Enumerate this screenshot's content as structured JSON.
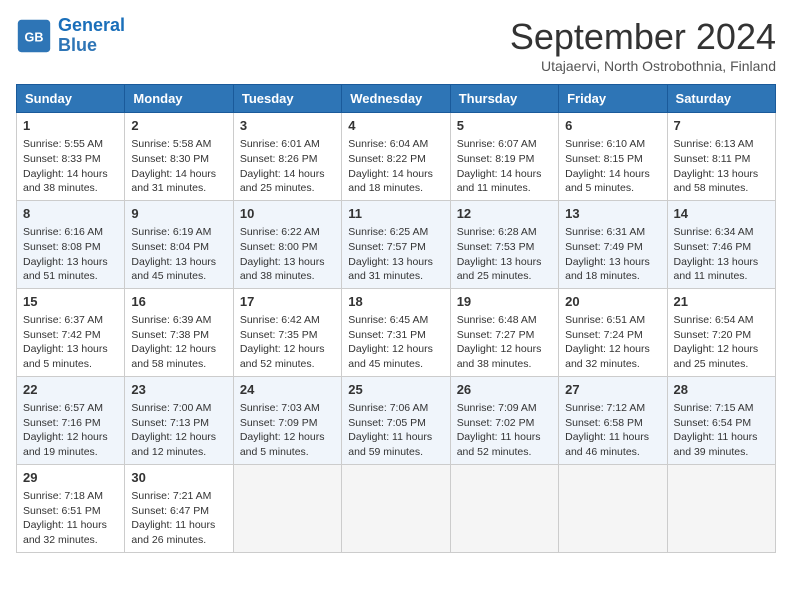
{
  "header": {
    "logo_line1": "General",
    "logo_line2": "Blue",
    "month": "September 2024",
    "location": "Utajaervi, North Ostrobothnia, Finland"
  },
  "days_of_week": [
    "Sunday",
    "Monday",
    "Tuesday",
    "Wednesday",
    "Thursday",
    "Friday",
    "Saturday"
  ],
  "weeks": [
    [
      {
        "day": 1,
        "lines": [
          "Sunrise: 5:55 AM",
          "Sunset: 8:33 PM",
          "Daylight: 14 hours",
          "and 38 minutes."
        ]
      },
      {
        "day": 2,
        "lines": [
          "Sunrise: 5:58 AM",
          "Sunset: 8:30 PM",
          "Daylight: 14 hours",
          "and 31 minutes."
        ]
      },
      {
        "day": 3,
        "lines": [
          "Sunrise: 6:01 AM",
          "Sunset: 8:26 PM",
          "Daylight: 14 hours",
          "and 25 minutes."
        ]
      },
      {
        "day": 4,
        "lines": [
          "Sunrise: 6:04 AM",
          "Sunset: 8:22 PM",
          "Daylight: 14 hours",
          "and 18 minutes."
        ]
      },
      {
        "day": 5,
        "lines": [
          "Sunrise: 6:07 AM",
          "Sunset: 8:19 PM",
          "Daylight: 14 hours",
          "and 11 minutes."
        ]
      },
      {
        "day": 6,
        "lines": [
          "Sunrise: 6:10 AM",
          "Sunset: 8:15 PM",
          "Daylight: 14 hours",
          "and 5 minutes."
        ]
      },
      {
        "day": 7,
        "lines": [
          "Sunrise: 6:13 AM",
          "Sunset: 8:11 PM",
          "Daylight: 13 hours",
          "and 58 minutes."
        ]
      }
    ],
    [
      {
        "day": 8,
        "lines": [
          "Sunrise: 6:16 AM",
          "Sunset: 8:08 PM",
          "Daylight: 13 hours",
          "and 51 minutes."
        ]
      },
      {
        "day": 9,
        "lines": [
          "Sunrise: 6:19 AM",
          "Sunset: 8:04 PM",
          "Daylight: 13 hours",
          "and 45 minutes."
        ]
      },
      {
        "day": 10,
        "lines": [
          "Sunrise: 6:22 AM",
          "Sunset: 8:00 PM",
          "Daylight: 13 hours",
          "and 38 minutes."
        ]
      },
      {
        "day": 11,
        "lines": [
          "Sunrise: 6:25 AM",
          "Sunset: 7:57 PM",
          "Daylight: 13 hours",
          "and 31 minutes."
        ]
      },
      {
        "day": 12,
        "lines": [
          "Sunrise: 6:28 AM",
          "Sunset: 7:53 PM",
          "Daylight: 13 hours",
          "and 25 minutes."
        ]
      },
      {
        "day": 13,
        "lines": [
          "Sunrise: 6:31 AM",
          "Sunset: 7:49 PM",
          "Daylight: 13 hours",
          "and 18 minutes."
        ]
      },
      {
        "day": 14,
        "lines": [
          "Sunrise: 6:34 AM",
          "Sunset: 7:46 PM",
          "Daylight: 13 hours",
          "and 11 minutes."
        ]
      }
    ],
    [
      {
        "day": 15,
        "lines": [
          "Sunrise: 6:37 AM",
          "Sunset: 7:42 PM",
          "Daylight: 13 hours",
          "and 5 minutes."
        ]
      },
      {
        "day": 16,
        "lines": [
          "Sunrise: 6:39 AM",
          "Sunset: 7:38 PM",
          "Daylight: 12 hours",
          "and 58 minutes."
        ]
      },
      {
        "day": 17,
        "lines": [
          "Sunrise: 6:42 AM",
          "Sunset: 7:35 PM",
          "Daylight: 12 hours",
          "and 52 minutes."
        ]
      },
      {
        "day": 18,
        "lines": [
          "Sunrise: 6:45 AM",
          "Sunset: 7:31 PM",
          "Daylight: 12 hours",
          "and 45 minutes."
        ]
      },
      {
        "day": 19,
        "lines": [
          "Sunrise: 6:48 AM",
          "Sunset: 7:27 PM",
          "Daylight: 12 hours",
          "and 38 minutes."
        ]
      },
      {
        "day": 20,
        "lines": [
          "Sunrise: 6:51 AM",
          "Sunset: 7:24 PM",
          "Daylight: 12 hours",
          "and 32 minutes."
        ]
      },
      {
        "day": 21,
        "lines": [
          "Sunrise: 6:54 AM",
          "Sunset: 7:20 PM",
          "Daylight: 12 hours",
          "and 25 minutes."
        ]
      }
    ],
    [
      {
        "day": 22,
        "lines": [
          "Sunrise: 6:57 AM",
          "Sunset: 7:16 PM",
          "Daylight: 12 hours",
          "and 19 minutes."
        ]
      },
      {
        "day": 23,
        "lines": [
          "Sunrise: 7:00 AM",
          "Sunset: 7:13 PM",
          "Daylight: 12 hours",
          "and 12 minutes."
        ]
      },
      {
        "day": 24,
        "lines": [
          "Sunrise: 7:03 AM",
          "Sunset: 7:09 PM",
          "Daylight: 12 hours",
          "and 5 minutes."
        ]
      },
      {
        "day": 25,
        "lines": [
          "Sunrise: 7:06 AM",
          "Sunset: 7:05 PM",
          "Daylight: 11 hours",
          "and 59 minutes."
        ]
      },
      {
        "day": 26,
        "lines": [
          "Sunrise: 7:09 AM",
          "Sunset: 7:02 PM",
          "Daylight: 11 hours",
          "and 52 minutes."
        ]
      },
      {
        "day": 27,
        "lines": [
          "Sunrise: 7:12 AM",
          "Sunset: 6:58 PM",
          "Daylight: 11 hours",
          "and 46 minutes."
        ]
      },
      {
        "day": 28,
        "lines": [
          "Sunrise: 7:15 AM",
          "Sunset: 6:54 PM",
          "Daylight: 11 hours",
          "and 39 minutes."
        ]
      }
    ],
    [
      {
        "day": 29,
        "lines": [
          "Sunrise: 7:18 AM",
          "Sunset: 6:51 PM",
          "Daylight: 11 hours",
          "and 32 minutes."
        ]
      },
      {
        "day": 30,
        "lines": [
          "Sunrise: 7:21 AM",
          "Sunset: 6:47 PM",
          "Daylight: 11 hours",
          "and 26 minutes."
        ]
      },
      null,
      null,
      null,
      null,
      null
    ]
  ]
}
